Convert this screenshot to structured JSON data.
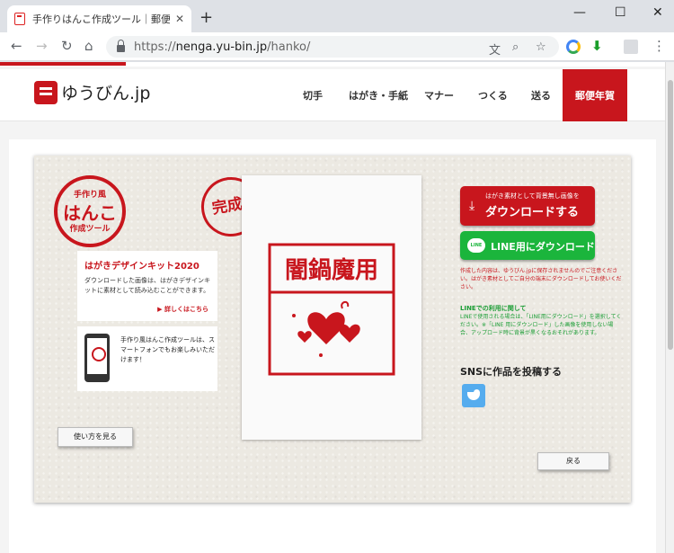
{
  "browser": {
    "tab_title": "手作りはんこ作成ツール｜郵便年",
    "tab_close": "✕",
    "new_tab": "+",
    "url_scheme": "https://",
    "url_host": "nenga.yu-bin.jp",
    "url_path": "/hanko/"
  },
  "site": {
    "logo_text": "ゆうびん.jp",
    "nav": [
      "切手",
      "はがき・手紙",
      "マナー",
      "つくる",
      "送る"
    ],
    "nav_highlight": "郵便年賀"
  },
  "left": {
    "badge_line1": "手作り風",
    "badge_line2": "はんこ",
    "badge_line3": "作成ツール",
    "kit_heading": "はがきデザインキット2020",
    "kit_text": "ダウンロードした画像は、はがきデザインキットに素材として読み込むことができます。",
    "kit_more": "▶ 詳しくはこちら",
    "phone_text": "手作り風はんこ作成ツールは、スマートフォンでもお楽しみいただけます！",
    "how_button": "使い方を見る"
  },
  "center": {
    "kansei": "完成!",
    "stamp_text": "闇鍋魔用"
  },
  "right": {
    "dl_sub": "はがき素材として背景無し画像を",
    "dl_main": "ダウンロードする",
    "dl_icon": "⤓",
    "line_icon": "LINE",
    "line_button": "LINE用にダウンロード",
    "note1": "作成した内容は、ゆうびん.jpに保存されませんのでご注意ください。はがき素材としてご自分の端末にダウンロードしてお使いください。",
    "line_heading": "LINEでの利用に関して",
    "note2": "LINEで使用される場合は、「LINE用にダウンロード」を選択してください。※「LINE 用にダウンロード」した画像を使用しない場合、アップロード時に背景が黒くなるおそれがあります。",
    "sns_heading": "SNSに作品を投稿する",
    "back_button": "戻る"
  },
  "colors": {
    "brand_red": "#c8161d",
    "line_green": "#1bb53c",
    "twitter_blue": "#55acee"
  }
}
